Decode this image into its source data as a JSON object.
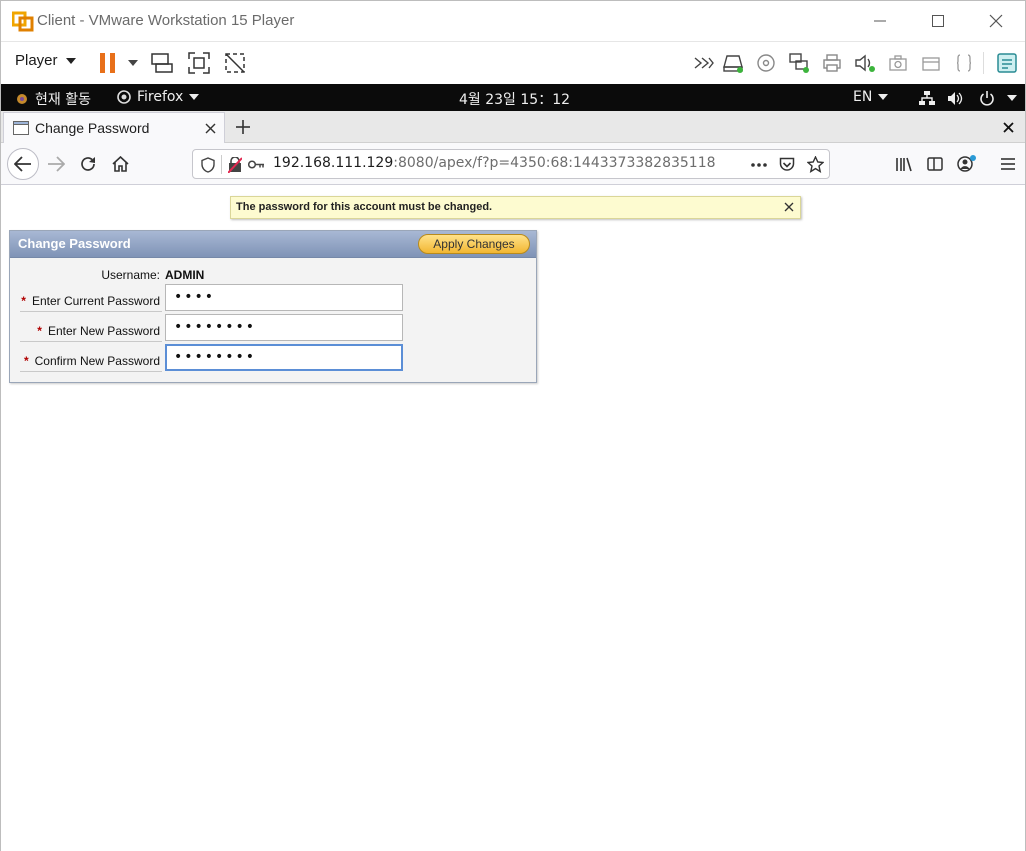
{
  "vmware": {
    "title": "Client - VMware Workstation 15 Player",
    "player_menu": "Player",
    "toolbar_icons": [
      "pause-icon",
      "send-ctrl-alt-del-icon",
      "fullscreen-icon",
      "unity-icon",
      "expand-devices-icon",
      "hard-disk-icon",
      "cd-dvd-icon",
      "network-adapter-icon",
      "printer-icon",
      "sound-card-icon",
      "camera-icon",
      "usb-icon",
      "floppy-icon",
      "notes-icon"
    ]
  },
  "gnome": {
    "activities": "현재 활동",
    "app": "Firefox",
    "clock": "4월 23일  15：12",
    "input_method": "EN"
  },
  "firefox": {
    "tab_title": "Change Password",
    "url_host": "192.168.111.129",
    "url_rest": ":8080/apex/f?p=4350:68:1443373382835118"
  },
  "page": {
    "notice": "The password for this account must be changed.",
    "region_title": "Change Password",
    "apply_button": "Apply Changes",
    "username_label": "Username:",
    "username_value": "ADMIN",
    "current_password_label": "Enter Current Password",
    "current_password_value": "••••",
    "new_password_label": "Enter New Password",
    "new_password_value": "••••••••",
    "confirm_password_label": "Confirm New Password",
    "confirm_password_value": "••••••••",
    "required_marker": "*"
  },
  "colors": {
    "accent": "#f2b632",
    "region_header": "#8fa1c0",
    "notice_bg": "#fdfbd0",
    "required": "#b00000"
  }
}
